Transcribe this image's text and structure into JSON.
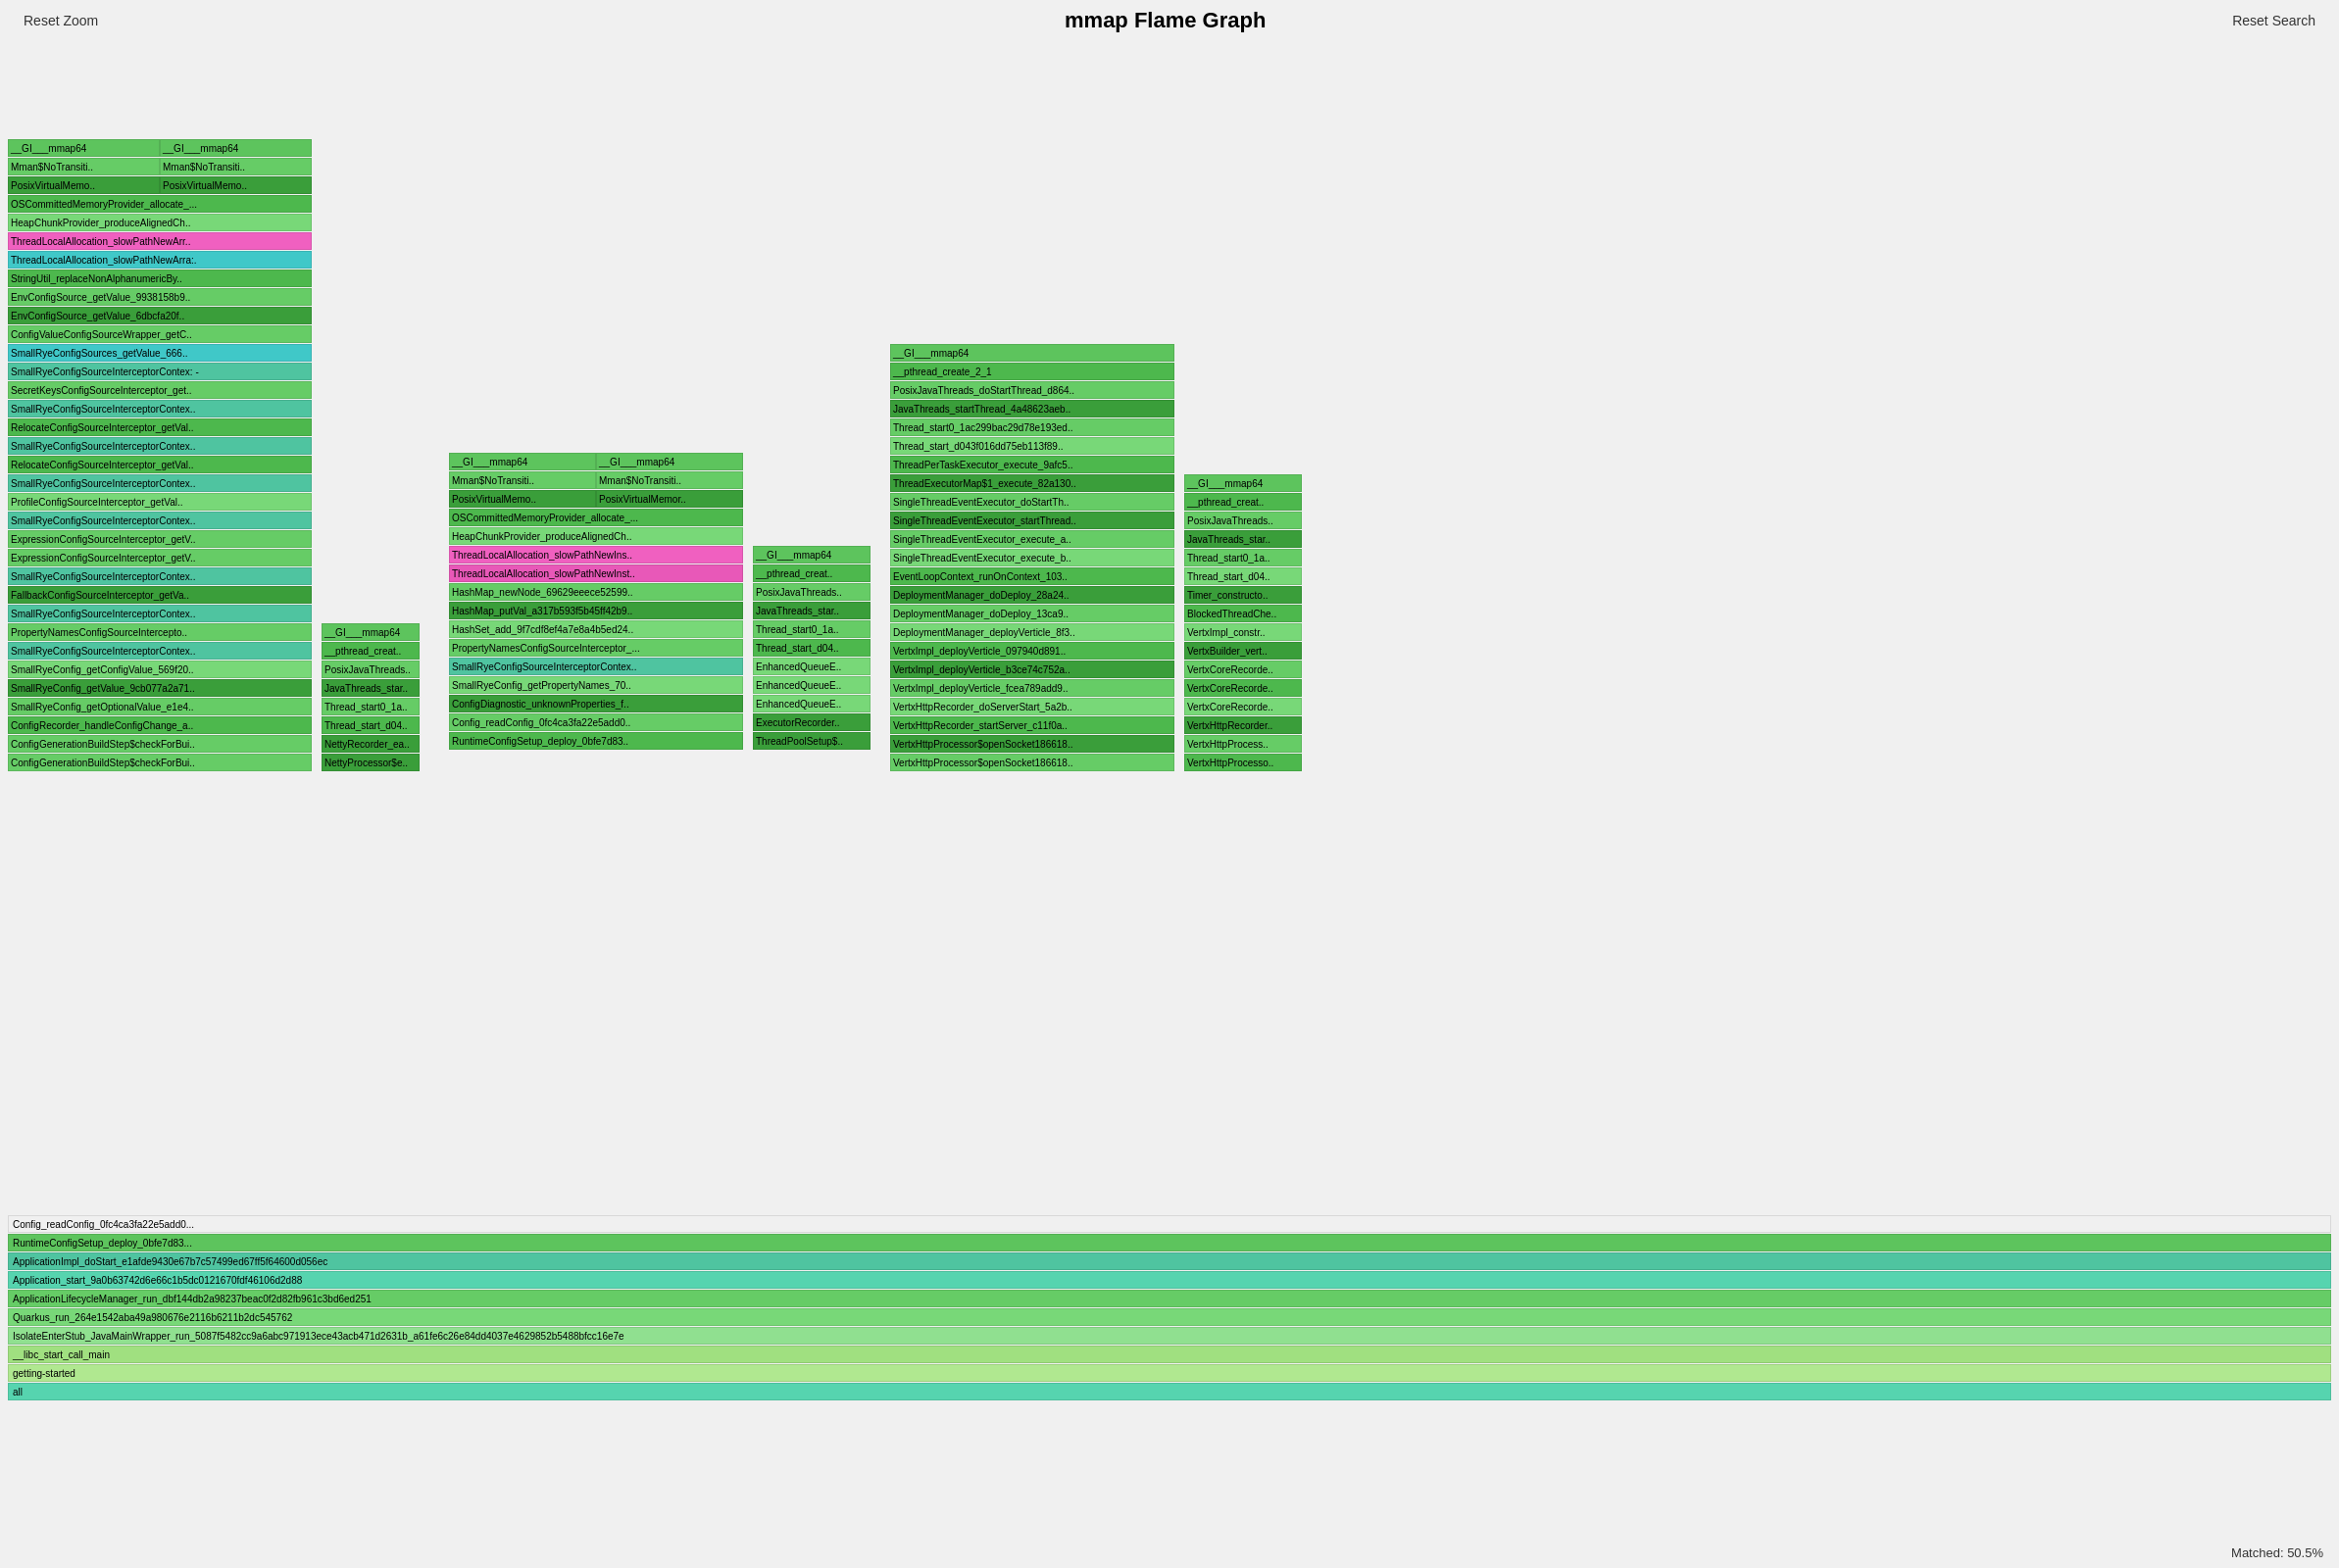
{
  "header": {
    "title": "mmap Flame Graph",
    "reset_zoom": "Reset Zoom",
    "reset_search": "Reset Search"
  },
  "status": {
    "matched": "Matched: 50.5%"
  },
  "bottom_frames": [
    {
      "label": "all",
      "color": "teal2",
      "width_pct": 100
    },
    {
      "label": "getting-started",
      "color": "teal2",
      "width_pct": 100
    },
    {
      "label": "__libc_start_call_main",
      "color": "green3",
      "width_pct": 100
    },
    {
      "label": "IsolateEnterStub_JavaMainWrapper_run_5087f5482cc9a6abc971913ece43acb471d2631b_a61fe6c26e84dd4037e4629852b5488bfcc16e7e",
      "color": "green3",
      "width_pct": 100
    },
    {
      "label": "Quarkus_run_264e1542aba49a980676e2116b6211b2dc545762",
      "color": "green3",
      "width_pct": 100
    },
    {
      "label": "ApplicationLifecycleManager_run_dbf144db2a98237beac0f2d82fb961c3bd6ed251",
      "color": "green3",
      "width_pct": 100
    },
    {
      "label": "Application_start_9a0b63742d6e66c1b5dc0121670fdf46106d2d88",
      "color": "green3",
      "width_pct": 100
    },
    {
      "label": "ApplicationImpl_doStart_e1afde9430e67b7c57499ed67ff5f64600d056ec",
      "color": "green3",
      "width_pct": 100
    }
  ]
}
